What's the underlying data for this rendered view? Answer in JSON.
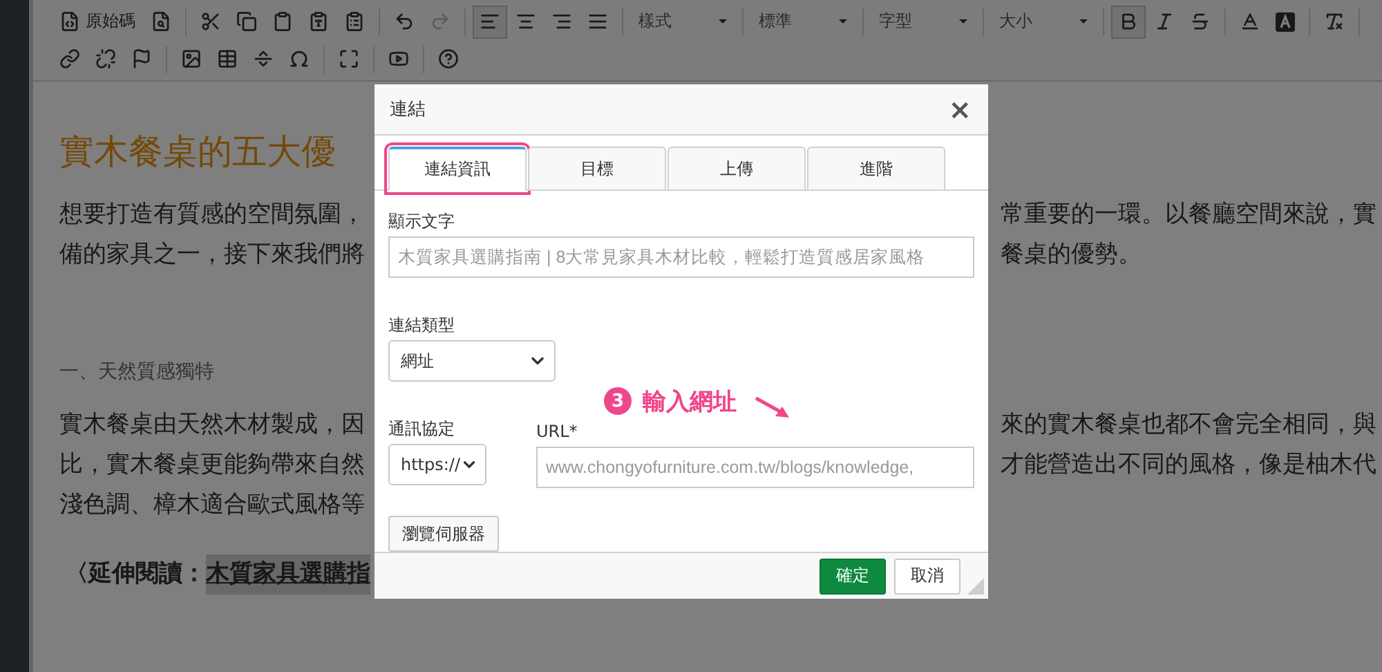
{
  "toolbar": {
    "source_label": "原始碼",
    "redo": {
      "disabled": true
    },
    "alignments": [
      {
        "selected": true
      },
      {
        "selected": false
      },
      {
        "selected": false
      },
      {
        "selected": false
      }
    ],
    "dropdowns": [
      {
        "label": "樣式"
      },
      {
        "label": "標準"
      },
      {
        "label": "字型"
      },
      {
        "label": "大小"
      }
    ],
    "formats": [
      {
        "active": true
      },
      {
        "active": false
      },
      {
        "active": false
      }
    ]
  },
  "document": {
    "heading": "實木餐桌的五大優",
    "blocks": [
      {
        "kind": "paragraph",
        "lines": [
          {
            "left": "想要打造有質感的空間氛圍，",
            "right": "常重要的一環。以餐廳空間來說，實"
          },
          {
            "left": "備的家具之一，接下來我們將",
            "right": "餐桌的優勢。"
          }
        ]
      },
      {
        "kind": "subheading",
        "lines": [
          {
            "left": "一、天然質感獨特"
          }
        ]
      },
      {
        "kind": "paragraph",
        "lines": [
          {
            "left": "實木餐桌由天然木材製成，因",
            "right": "來的實木餐桌也都不會完全相同，與"
          },
          {
            "left": "比，實木餐桌更能夠帶來自然",
            "right": "才能營造出不同的風格，像是柚木代"
          },
          {
            "left": "淺色調、樟木適合歐式風格等"
          }
        ]
      },
      {
        "kind": "reading",
        "prefix": "〈延伸閱讀：",
        "link": "木質家具選購指"
      }
    ]
  },
  "dialog": {
    "title": "連結",
    "close": "×",
    "tabs": [
      {
        "label": "連結資訊",
        "selected": true,
        "highlighted": true
      },
      {
        "label": "目標",
        "selected": false,
        "highlighted": false
      },
      {
        "label": "上傳",
        "selected": false,
        "highlighted": false
      },
      {
        "label": "進階",
        "selected": false,
        "highlighted": false
      }
    ],
    "display_text": {
      "label": "顯示文字",
      "value": "木質家具選購指南 | 8大常見家具木材比較，輕鬆打造質感居家風格"
    },
    "link_type": {
      "label": "連結類型",
      "value": "網址"
    },
    "protocol": {
      "label": "通訊協定",
      "value": "https://"
    },
    "url": {
      "label": "URL*",
      "value": "www.chongyofurniture.com.tw/blogs/knowledge,"
    },
    "browse_button": "瀏覽伺服器",
    "annotation": {
      "number": "3",
      "text": "輸入網址"
    },
    "buttons": [
      {
        "label": "確定",
        "kind": "primary"
      },
      {
        "label": "取消",
        "kind": "secondary"
      }
    ]
  }
}
